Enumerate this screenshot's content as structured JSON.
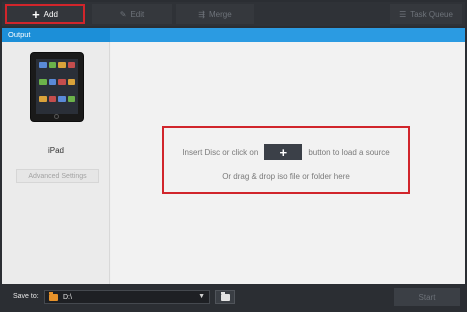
{
  "toolbar": {
    "add_label": "Add",
    "edit_label": "Edit",
    "merge_label": "Merge",
    "queue_label": "Task Queue"
  },
  "tabs": {
    "output_label": "Output"
  },
  "device": {
    "name": "iPad",
    "advanced_label": "Advanced Settings"
  },
  "dropzone": {
    "line1_before": "Insert Disc or click on",
    "line1_after": "button to load a source",
    "line2": "Or drag & drop iso file or folder here"
  },
  "bottom": {
    "save_label": "Save to:",
    "path_value": "D:\\",
    "start_label": "Start"
  },
  "colors": {
    "accent_blue": "#1c8fd8",
    "highlight_red": "#d1252b",
    "dark_bg": "#2b2e33"
  }
}
